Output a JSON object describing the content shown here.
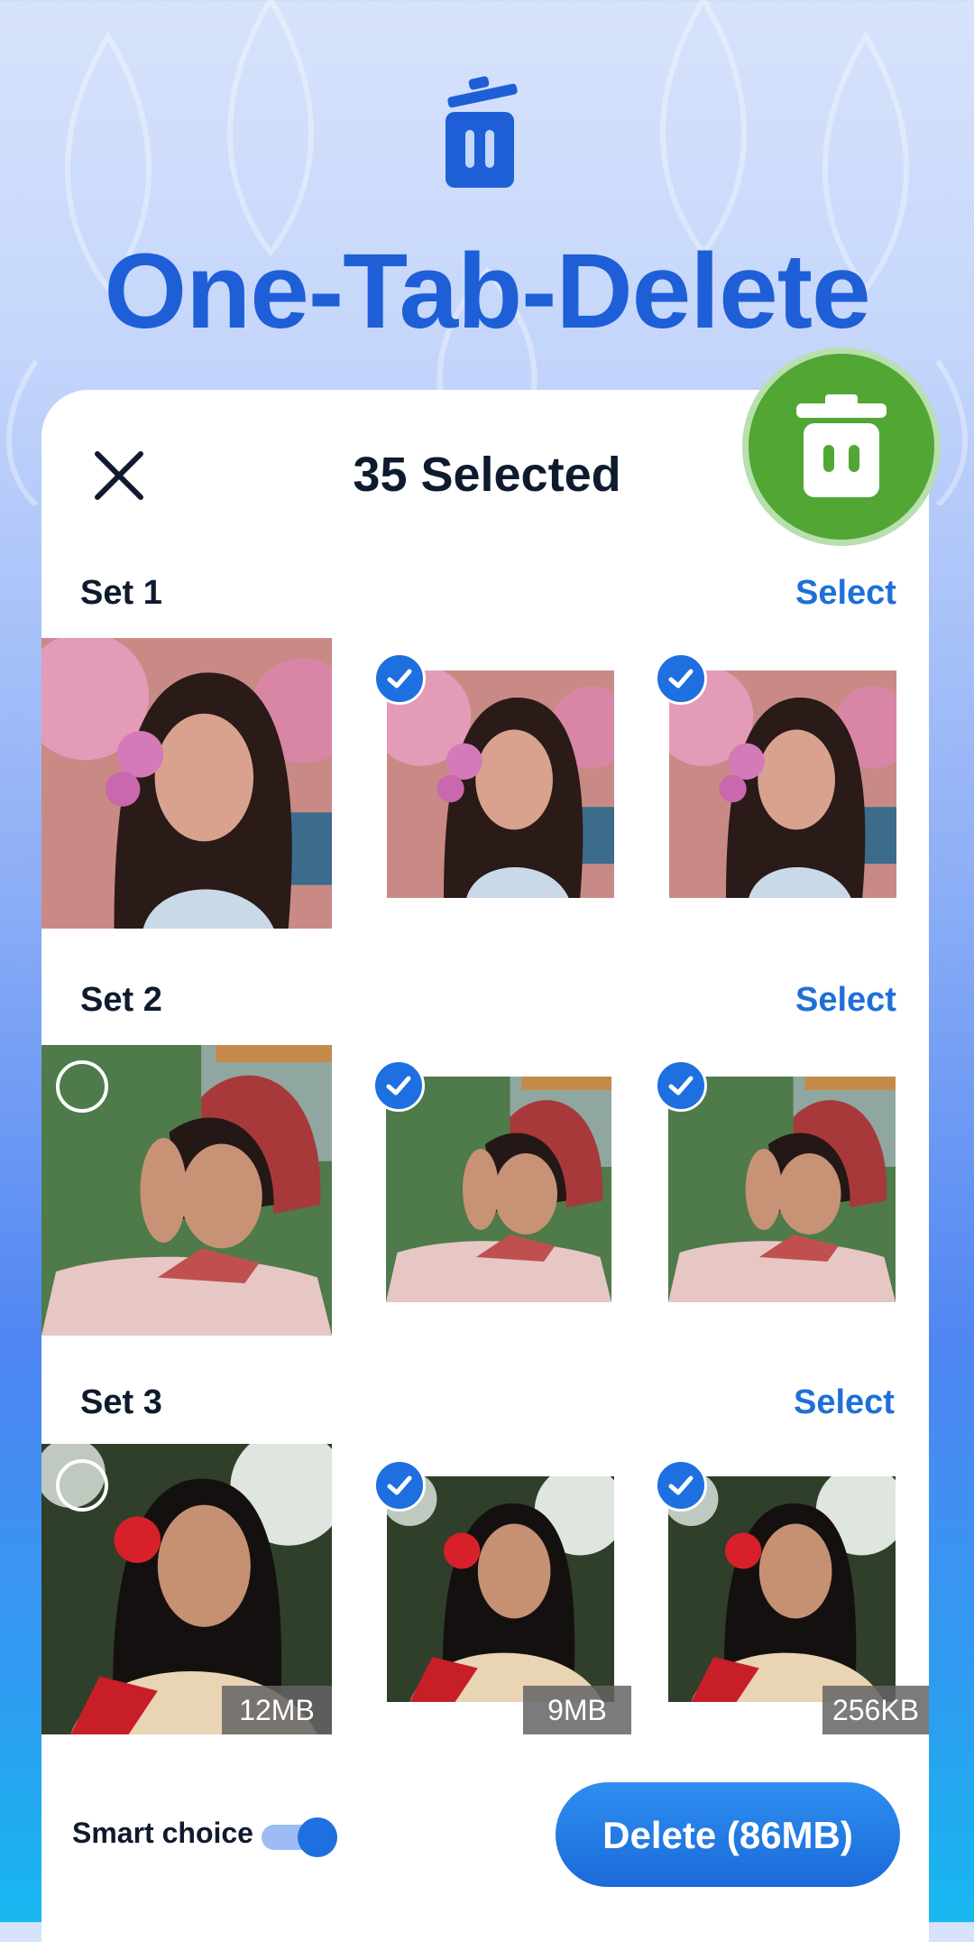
{
  "hero": {
    "title": "One-Tab-Delete",
    "icon": "trash-icon"
  },
  "header": {
    "close_icon": "close-icon",
    "title": "35 Selected",
    "fab_icon": "trash-icon"
  },
  "sets": [
    {
      "label": "Set 1",
      "action": "Select",
      "photos": [
        {
          "checked": false,
          "radio": false,
          "size": ""
        },
        {
          "checked": true,
          "size": ""
        },
        {
          "checked": true,
          "size": ""
        }
      ]
    },
    {
      "label": "Set 2",
      "action": "Select",
      "photos": [
        {
          "checked": false,
          "radio": true,
          "size": ""
        },
        {
          "checked": true,
          "size": ""
        },
        {
          "checked": true,
          "size": ""
        }
      ]
    },
    {
      "label": "Set 3",
      "action": "Select",
      "photos": [
        {
          "checked": false,
          "radio": true,
          "size": "12MB"
        },
        {
          "checked": true,
          "size": "9MB"
        },
        {
          "checked": true,
          "size": "256KB"
        }
      ]
    }
  ],
  "footer": {
    "smart_choice_label": "Smart choice",
    "smart_choice_on": true,
    "delete_label": "Delete (86MB)"
  },
  "colors": {
    "accent": "#1e6fe0",
    "title": "#1e5fd8",
    "fab": "#52a634"
  }
}
